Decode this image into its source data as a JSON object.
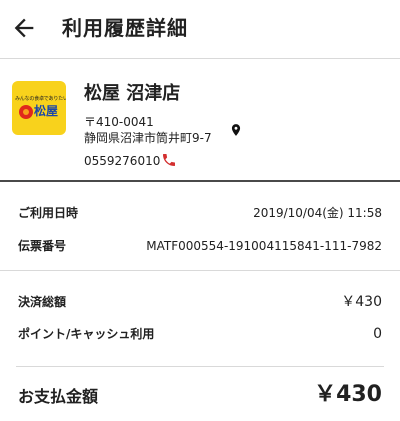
{
  "header": {
    "title": "利用履歴詳細",
    "back_icon": "arrow-back-icon"
  },
  "store": {
    "logo": {
      "tagline": "みんなの食卓でありたい。",
      "brand": "松屋",
      "colors": {
        "bg": "#f8d21c",
        "text": "#1a47a8",
        "bowl": "#e0281c"
      }
    },
    "name": "松屋 沼津店",
    "postal": "〒410-0041",
    "address": "静岡県沼津市筒井町9-7",
    "phone": "0559276010",
    "map_icon": "location-pin-icon",
    "phone_icon": "phone-icon"
  },
  "details": {
    "date_label": "ご利用日時",
    "date_value": "2019/10/04(金) 11:58",
    "slip_label": "伝票番号",
    "slip_value": "MATF000554-191004115841-111-7982"
  },
  "payment": {
    "total_label": "決済総額",
    "total_value": "￥430",
    "points_label": "ポイント/キャッシュ利用",
    "points_value": "0"
  },
  "summary": {
    "pay_label": "お支払金額",
    "pay_value": "￥430"
  },
  "colors": {
    "phone_icon": "#d32f2f",
    "divider_dark": "#4a4a4a"
  }
}
